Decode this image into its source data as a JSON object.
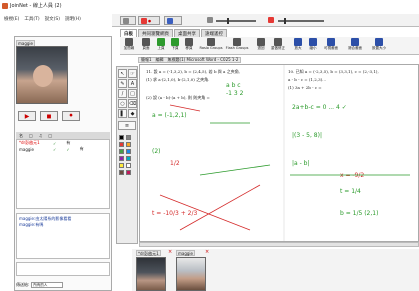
{
  "window": {
    "title": "JoinNet - 線上人員 (2)"
  },
  "menu": [
    "檢視(E)",
    "工具(T)",
    "說文(S)",
    "說明(H)"
  ],
  "left": {
    "user_tag": "maggie",
    "list_headers": [
      "名",
      "□",
      "♫",
      "□"
    ],
    "users": [
      {
        "name": "*dr彭啟元1",
        "c1": "✓",
        "c2": "",
        "c3": "有",
        "red": true
      },
      {
        "name": "maggie",
        "c1": "✓",
        "c2": "✓",
        "c3": "有",
        "red": false
      }
    ],
    "chat": [
      "maggie:由太陽系的影像看看",
      "maggie:有嗎"
    ],
    "sendto_label": "傳送給:",
    "sendto_value": "所有的人"
  },
  "tabs": [
    "白板",
    "共同瀏覽網頁",
    "桌面共享",
    "遠端遙控"
  ],
  "toolbar": [
    {
      "label": "加簡報",
      "color": "gray"
    },
    {
      "label": "頁面",
      "color": "gray"
    },
    {
      "label": "上頁",
      "color": "green"
    },
    {
      "label": "下頁",
      "color": "green"
    },
    {
      "label": "移頁",
      "color": "gray"
    },
    {
      "label": "Rasio Groups",
      "color": "gray"
    },
    {
      "label": "Flash Groups",
      "color": "gray"
    },
    {
      "label": "退回",
      "color": "gray"
    },
    {
      "label": "重做修正",
      "color": "gray"
    },
    {
      "label": "放大",
      "color": "blue"
    },
    {
      "label": "縮小",
      "color": "blue"
    },
    {
      "label": "可視畫面",
      "color": "blue"
    },
    {
      "label": "適合畫面",
      "color": "blue"
    },
    {
      "label": "設置大小",
      "color": "blue"
    }
  ],
  "doc_tab": {
    "left": "簡報1",
    "right": "編輯",
    "title": "無標題(1) Microsoft Word - C025 1-2"
  },
  "whiteboard": {
    "printed": [
      "11. 設 a = (-1,3,2), b = (2,4,5), 若 b 與 a 之夾角,",
      "(1) 求 a·(2,1,0), b·(2,1,0) 之夾角.",
      "(2) 設 (a - b)·(a + b), 則 則夾角 =",
      "10. 已知 a = (-2,3,5), b = (3,3,1), c = (2,-3,1),",
      "a - b - c = (1,2,3)...",
      "(1) 3a + 2b - c ="
    ],
    "handwriting_green": [
      "a b c",
      "-1 3 2",
      "a = (-1,2,1)",
      "2a+b-c = 0 ... 4 ✓",
      "(2)",
      "|a - b|",
      "|(3 - 5, 8)|",
      "t = 1/4",
      "b = 1/5 (2,1)"
    ],
    "handwriting_red": [
      "1/2",
      "x = -9/2",
      "t = -10/3 + 2/3"
    ]
  },
  "thumbs": [
    {
      "tag": "*dr彭啟元1"
    },
    {
      "tag": "maggie"
    }
  ]
}
